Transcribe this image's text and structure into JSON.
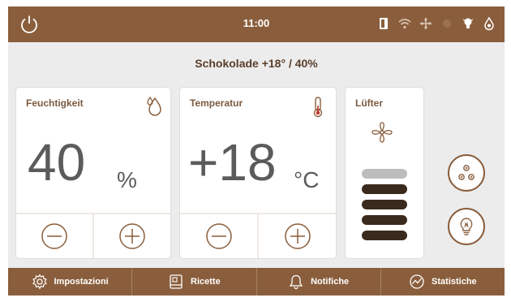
{
  "status_bar": {
    "time": "11:00",
    "icons": [
      "power-icon",
      "door-icon",
      "wifi-icon",
      "fan-icon",
      "light-icon",
      "drop-icon"
    ]
  },
  "recipe": {
    "title": "Schokolade +18° / 40%"
  },
  "humidity": {
    "label": "Feuchtigkeit",
    "value": "40",
    "unit": "%",
    "icon": "humidity-drop-icon"
  },
  "temperature": {
    "label": "Temperatur",
    "value": "+18",
    "unit": "°C",
    "icon": "thermometer-icon"
  },
  "fan": {
    "label": "Lüfter",
    "icon": "fan-icon",
    "level": 4,
    "max_level": 5
  },
  "side_buttons": [
    "fan-mode-icon",
    "lightbulb-icon"
  ],
  "nav": [
    {
      "label": "Impostazioni",
      "icon": "gear-icon"
    },
    {
      "label": "Ricette",
      "icon": "book-icon"
    },
    {
      "label": "Notifiche",
      "icon": "bell-icon"
    },
    {
      "label": "Statistiche",
      "icon": "chart-icon"
    }
  ],
  "colors": {
    "brand": "#8a5e3c",
    "background": "#ececec",
    "card": "#ffffff",
    "value_text": "#5b5b5b",
    "fan_bar_on": "#3a2a1e",
    "fan_bar_off": "#bdbdbd"
  }
}
